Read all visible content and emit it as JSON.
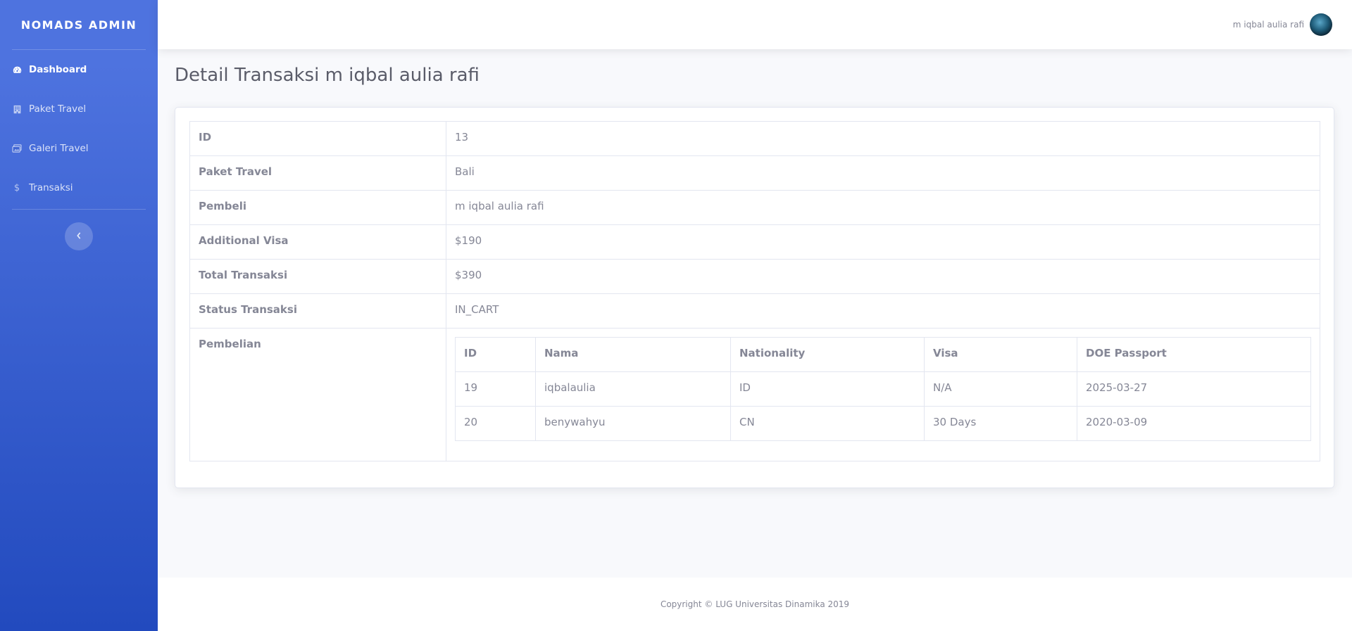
{
  "brand": "NOMADS ADMIN",
  "sidebar": {
    "items": [
      {
        "label": "Dashboard",
        "icon": "tachometer-icon",
        "active": true
      },
      {
        "label": "Paket Travel",
        "icon": "hotel-icon"
      },
      {
        "label": "Galeri Travel",
        "icon": "images-icon"
      },
      {
        "label": "Transaksi",
        "icon": "dollar-icon"
      }
    ],
    "toggle_icon": "chevron-left-icon"
  },
  "topbar": {
    "user_name": "m iqbal aulia rafi"
  },
  "page": {
    "title": "Detail Transaksi m iqbal aulia rafi"
  },
  "detail": {
    "id_label": "ID",
    "id_value": "13",
    "paket_label": "Paket Travel",
    "paket_value": "Bali",
    "pembeli_label": "Pembeli",
    "pembeli_value": "m iqbal aulia rafi",
    "visa_label": "Additional Visa",
    "visa_value": "$190",
    "total_label": "Total Transaksi",
    "total_value": "$390",
    "status_label": "Status Transaksi",
    "status_value": "IN_CART",
    "pembelian_label": "Pembelian"
  },
  "pembelian": {
    "headers": [
      "ID",
      "Nama",
      "Nationality",
      "Visa",
      "DOE Passport"
    ],
    "rows": [
      [
        "19",
        "iqbalaulia",
        "ID",
        "N/A",
        "2025-03-27"
      ],
      [
        "20",
        "benywahyu",
        "CN",
        "30 Days",
        "2020-03-09"
      ]
    ]
  },
  "footer": {
    "text": "Copyright © LUG Universitas Dinamika 2019"
  },
  "colors": {
    "sidebar_top": "#4e73df",
    "sidebar_bottom": "#224abe",
    "text": "#858796",
    "title": "#5a5c69"
  }
}
